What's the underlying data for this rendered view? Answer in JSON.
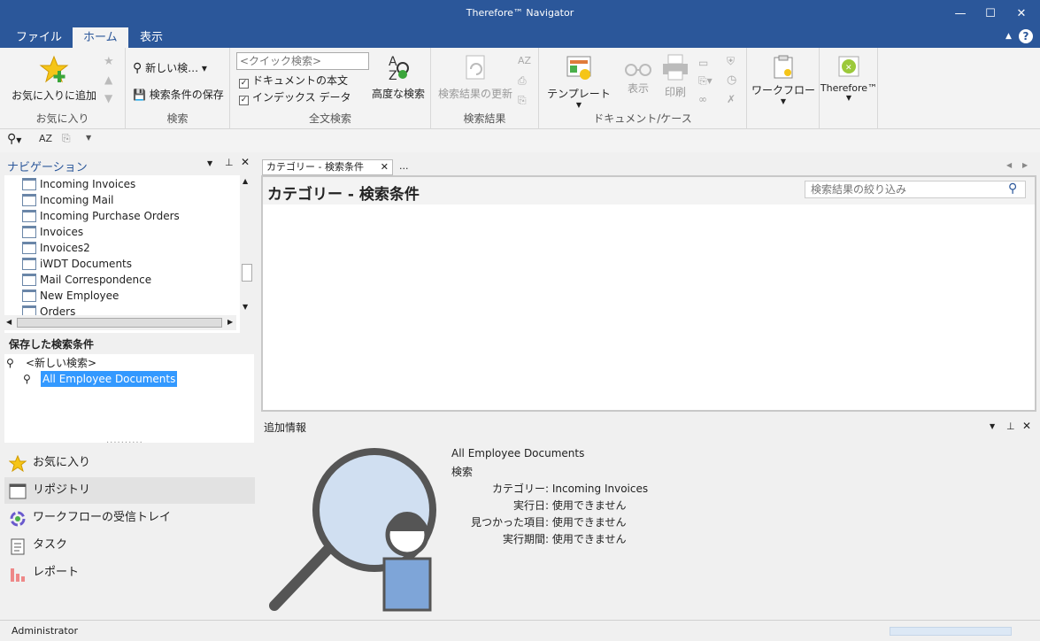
{
  "window": {
    "title": "Therefore™ Navigator"
  },
  "menu_tabs": [
    {
      "label": "ファイル"
    },
    {
      "label": "ホーム"
    },
    {
      "label": "表示"
    }
  ],
  "ribbon": {
    "favorites": {
      "add_label": "お気に入りに追加",
      "group_label": "お気に入り"
    },
    "search": {
      "new_search_label": "新しい検…",
      "save_search_label": "検索条件の保存",
      "group_label": "検索"
    },
    "fulltext": {
      "quick_search_placeholder": "<クイック検索>",
      "document_text_label": "ドキュメントの本文",
      "index_data_label": "インデックス データ",
      "advanced_label": "高度な検索",
      "group_label": "全文検索"
    },
    "results": {
      "refresh_label": "検索結果の更新",
      "group_label": "検索結果"
    },
    "document": {
      "template_label": "テンプレート",
      "view_label": "表示",
      "print_label": "印刷",
      "group_label": "ドキュメント/ケース"
    },
    "workflow": {
      "label": "ワークフロー"
    },
    "therefore": {
      "label": "Therefore™"
    }
  },
  "navigation": {
    "header": "ナビゲーション",
    "tree_items": [
      "Incoming Invoices",
      "Incoming Mail",
      "Incoming Purchase Orders",
      "Invoices",
      "Invoices2",
      "iWDT Documents",
      "Mail Correspondence",
      "New Employee",
      "Orders"
    ],
    "saved_header": "保存した検索条件",
    "saved_items": [
      "<新しい検索>",
      "All Employee Documents"
    ],
    "bottom_items": [
      {
        "label": "お気に入り"
      },
      {
        "label": "リポジトリ"
      },
      {
        "label": "ワークフローの受信トレイ"
      },
      {
        "label": "タスク"
      },
      {
        "label": "レポート"
      }
    ]
  },
  "doc_tab": {
    "label": "カテゴリー - 検索条件",
    "overflow": "...",
    "heading": "カテゴリー - 検索条件",
    "filter_placeholder": "検索結果の絞り込み"
  },
  "additional_info": {
    "header": "追加情報",
    "name": "All Employee Documents",
    "type": "検索",
    "fields": [
      {
        "label": "カテゴリー:",
        "value": "Incoming Invoices"
      },
      {
        "label": "実行日:",
        "value": "使用できません"
      },
      {
        "label": "見つかった項目:",
        "value": "使用できません"
      },
      {
        "label": "実行期間:",
        "value": "使用できません"
      }
    ]
  },
  "status": {
    "user": "Administrator"
  },
  "colors": {
    "accent": "#2b579a",
    "selection": "#3399ff"
  }
}
